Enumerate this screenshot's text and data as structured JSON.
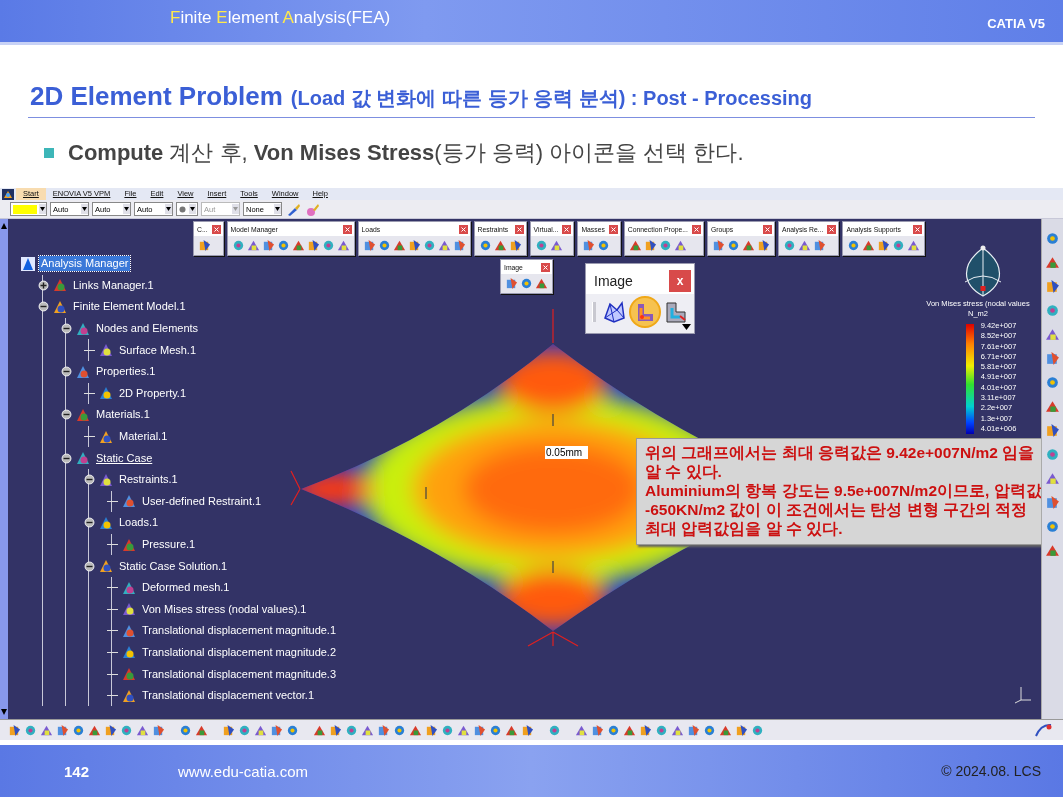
{
  "slide": {
    "title_parts": [
      {
        "text": "F",
        "accent": true
      },
      {
        "text": "inite ",
        "accent": false
      },
      {
        "text": "E",
        "accent": true
      },
      {
        "text": "lement ",
        "accent": false
      },
      {
        "text": "A",
        "accent": true
      },
      {
        "text": "nalysis(FEA)",
        "accent": false
      }
    ],
    "brand": "CATIA V5"
  },
  "heading": {
    "main": "2D Element Problem",
    "sub": "(Load 값 변화에 따른 등가 응력 분석) : Post - Processing"
  },
  "bullet": "**Compute** 계산 후, **Von Mises Stress**(등가 응력) 아이콘을 선택 한다.",
  "app": {
    "menu": [
      {
        "label": "Start",
        "selected": true
      },
      {
        "label": "ENOVIA V5 VPM",
        "selected": false
      },
      {
        "label": "File",
        "selected": false
      },
      {
        "label": "Edit",
        "selected": false
      },
      {
        "label": "View",
        "selected": false
      },
      {
        "label": "Insert",
        "selected": false
      },
      {
        "label": "Tools",
        "selected": false
      },
      {
        "label": "Window",
        "selected": false
      },
      {
        "label": "Help",
        "selected": false
      }
    ],
    "format_bar": [
      {
        "kind": "color",
        "color": "#ffff00"
      },
      {
        "kind": "combo",
        "value": "Auto",
        "disabled": false
      },
      {
        "kind": "combo",
        "value": "Auto",
        "disabled": false
      },
      {
        "kind": "combo",
        "value": "Auto",
        "disabled": false
      },
      {
        "kind": "point",
        "disabled": false
      },
      {
        "kind": "combo",
        "value": "Aut",
        "disabled": true
      },
      {
        "kind": "combo",
        "value": "None",
        "disabled": false
      }
    ],
    "toolbars": [
      {
        "title": "C..."
      },
      {
        "title": "Model Manager"
      },
      {
        "title": "Loads"
      },
      {
        "title": "Restraints"
      },
      {
        "title": "Virtual..."
      },
      {
        "title": "Masses"
      },
      {
        "title": "Connection Prope..."
      },
      {
        "title": "Groups"
      },
      {
        "title": "Analysis Re..."
      },
      {
        "title": "Analysis Supports"
      }
    ],
    "image_toolbar_small": {
      "title": "Image"
    },
    "image_toolbar_large": {
      "title": "Image",
      "close": "x",
      "tools": [
        {
          "selected": false
        },
        {
          "selected": true
        },
        {
          "selected": false
        }
      ]
    },
    "tree": [
      {
        "label": "Analysis Manager",
        "selected": true,
        "current": false,
        "children": [
          {
            "label": "Links Manager.1",
            "selected": false,
            "current": false,
            "expanded": false
          },
          {
            "label": "Finite Element Model.1",
            "selected": false,
            "current": false,
            "expanded": true,
            "children": [
              {
                "label": "Nodes and Elements",
                "selected": false,
                "current": false,
                "expanded": true,
                "children": [
                  {
                    "label": "Surface Mesh.1",
                    "selected": false,
                    "current": false
                  }
                ]
              },
              {
                "label": "Properties.1",
                "selected": false,
                "current": false,
                "expanded": true,
                "children": [
                  {
                    "label": "2D Property.1",
                    "selected": false,
                    "current": false
                  }
                ]
              },
              {
                "label": "Materials.1",
                "selected": false,
                "current": false,
                "expanded": true,
                "children": [
                  {
                    "label": "Material.1",
                    "selected": false,
                    "current": false
                  }
                ]
              },
              {
                "label": "Static Case",
                "selected": false,
                "current": true,
                "expanded": true,
                "children": [
                  {
                    "label": "Restraints.1",
                    "selected": false,
                    "current": false,
                    "expanded": true,
                    "children": [
                      {
                        "label": "User-defined Restraint.1",
                        "selected": false,
                        "current": false
                      }
                    ]
                  },
                  {
                    "label": "Loads.1",
                    "selected": false,
                    "current": false,
                    "expanded": true,
                    "children": [
                      {
                        "label": "Pressure.1",
                        "selected": false,
                        "current": false
                      }
                    ]
                  },
                  {
                    "label": "Static Case Solution.1",
                    "selected": false,
                    "current": false,
                    "expanded": true,
                    "children": [
                      {
                        "label": "Deformed mesh.1",
                        "selected": false,
                        "current": false
                      },
                      {
                        "label": "Von Mises stress (nodal values).1",
                        "selected": false,
                        "current": false
                      },
                      {
                        "label": "Translational displacement magnitude.1",
                        "selected": false,
                        "current": false
                      },
                      {
                        "label": "Translational displacement magnitude.2",
                        "selected": false,
                        "current": false
                      },
                      {
                        "label": "Translational displacement magnitude.3",
                        "selected": false,
                        "current": false
                      },
                      {
                        "label": "Translational displacement vector.1",
                        "selected": false,
                        "current": false
                      }
                    ]
                  }
                ]
              }
            ]
          }
        ]
      }
    ],
    "dimension_label": "0.05mm",
    "legend": {
      "title": "Von Mises stress (nodal values",
      "units": "N_m2",
      "values": [
        "9.42e+007",
        "8.52e+007",
        "7.61e+007",
        "6.71e+007",
        "5.81e+007",
        "4.91e+007",
        "4.01e+007",
        "3.11e+007",
        "2.2e+007",
        "1.3e+007",
        "4.01e+006"
      ]
    },
    "callout": [
      "위의 그래프에서는 최대 응력값은 **9.42e+007N/m2** 임을 알 수 있다.",
      "**Aluminium**의 항복 강도는 **9.5e+007N/m2**이므로, 압력값 **-650KN/m2** 값이 이 조건에서는 탄성 변형 구간의 적정 최대 압력값임을 알 수 있다."
    ]
  },
  "footer": {
    "page": "142",
    "site": "www.edu-catia.com",
    "copyright": "© 2024.08. LCS"
  }
}
